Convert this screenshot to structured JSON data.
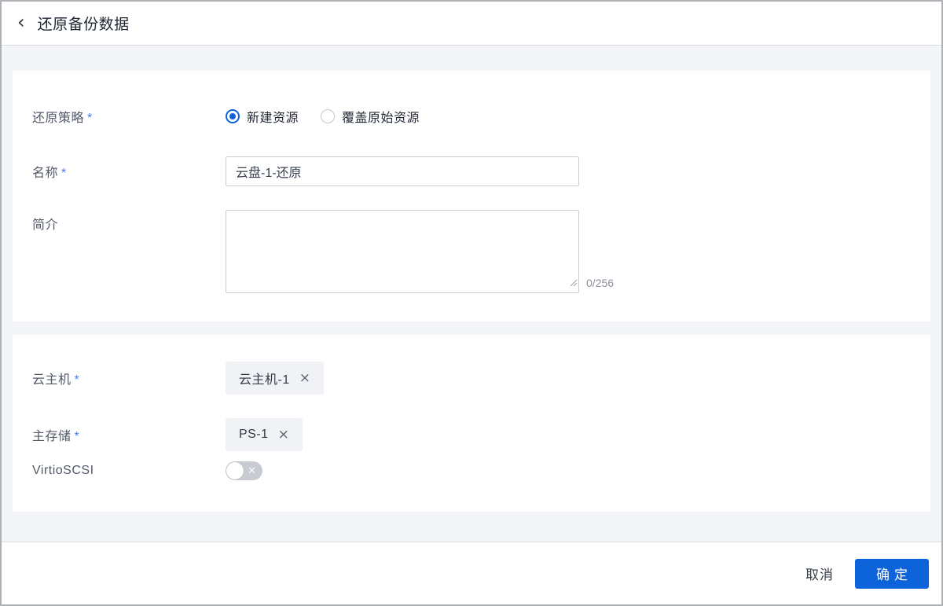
{
  "header": {
    "back_icon": "‹",
    "title": "还原备份数据"
  },
  "form": {
    "restore_policy": {
      "label": "还原策略",
      "required_mark": "*",
      "options": [
        {
          "label": "新建资源",
          "selected": true
        },
        {
          "label": "覆盖原始资源",
          "selected": false
        }
      ]
    },
    "name": {
      "label": "名称",
      "required_mark": "*",
      "value": "云盘-1-还原"
    },
    "description": {
      "label": "简介",
      "value": "",
      "counter": "0/256"
    },
    "vm": {
      "label": "云主机",
      "required_mark": "*",
      "tag": "云主机-1",
      "remove_icon": "×"
    },
    "primary_storage": {
      "label": "主存储",
      "required_mark": "*",
      "tag": "PS-1",
      "remove_icon": "×"
    },
    "virtio_scsi": {
      "label": "VirtioSCSI",
      "enabled": false,
      "off_icon": "×"
    }
  },
  "footer": {
    "cancel_label": "取消",
    "confirm_label": "确定"
  },
  "colors": {
    "accent_blue": "#0d64da",
    "radio_blue": "#1063d8",
    "required_asterisk": "#4a7df0",
    "page_background": "#f4f5f9",
    "panel_background": "#ffffff",
    "tag_background": "#f1f2f6",
    "toggle_off": "#c8cbd1"
  }
}
